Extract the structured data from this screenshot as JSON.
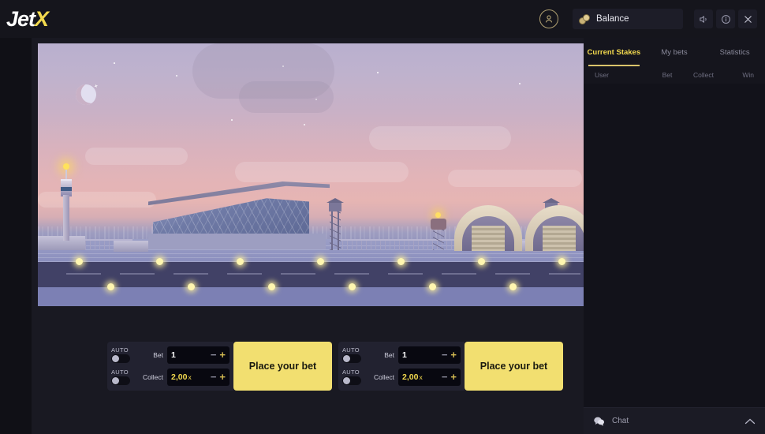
{
  "brand": {
    "name_part1": "Jet",
    "name_part2": "X"
  },
  "topbar": {
    "avatar_icon": "user-circle-icon",
    "balance_label": "Balance",
    "balance_icon": "coins-icon",
    "sound_icon": "sound-icon",
    "info_icon": "info-icon",
    "close_icon": "close-icon"
  },
  "sidebar": {
    "tabs": [
      {
        "label": "Current Stakes",
        "active": true
      },
      {
        "label": "My bets",
        "active": false
      },
      {
        "label": "Statistics",
        "active": false
      }
    ],
    "columns": {
      "user": "User",
      "bet": "Bet",
      "collect": "Collect",
      "win": "Win"
    },
    "rows": [],
    "chat": {
      "label": "Chat",
      "icon": "chat-bubble-icon",
      "expander_icon": "chevron-up-icon"
    }
  },
  "bet_panels": [
    {
      "auto_bet_label": "AUTO",
      "auto_collect_label": "AUTO",
      "bet_label": "Bet",
      "bet_value": "1",
      "collect_label": "Collect",
      "collect_value": "2,00",
      "collect_unit": "x",
      "minus_icon": "minus-icon",
      "plus_icon": "plus-icon",
      "place_button": "Place your bet"
    },
    {
      "auto_bet_label": "AUTO",
      "auto_collect_label": "AUTO",
      "bet_label": "Bet",
      "bet_value": "1",
      "collect_label": "Collect",
      "collect_value": "2,00",
      "collect_unit": "x",
      "minus_icon": "minus-icon",
      "plus_icon": "plus-icon",
      "place_button": "Place your bet"
    }
  ],
  "colors": {
    "accent_yellow": "#f2d94e",
    "button_yellow": "#f2df70",
    "background_dark": "#101016",
    "panel_dark": "#191922",
    "sidebar_dark": "#15151d"
  },
  "scene": {
    "description": "pixel-art airport at dusk",
    "elements": [
      "moon",
      "stars",
      "clouds",
      "control-tower",
      "terminal",
      "hangars",
      "watchtower",
      "water-tower",
      "runway",
      "sea"
    ]
  }
}
